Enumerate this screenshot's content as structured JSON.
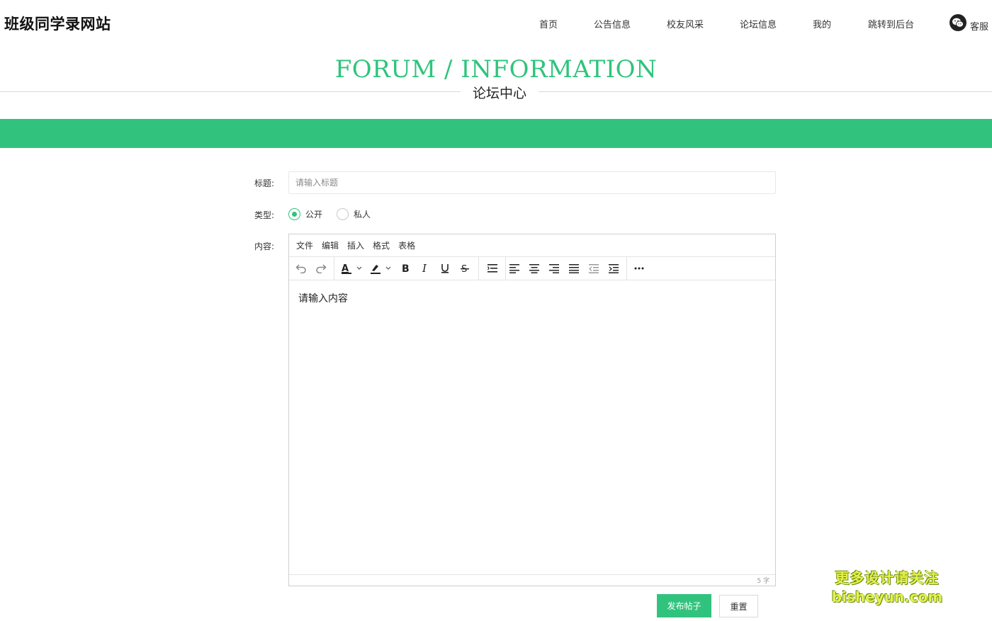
{
  "header": {
    "site_title": "班级同学录网站",
    "nav": [
      "首页",
      "公告信息",
      "校友风采",
      "论坛信息",
      "我的",
      "跳转到后台"
    ],
    "service_label": "客服"
  },
  "section": {
    "title_en": "FORUM / INFORMATION",
    "title_cn": "论坛中心"
  },
  "form": {
    "title_label": "标题:",
    "title_placeholder": "请输入标题",
    "type_label": "类型:",
    "type_options": [
      {
        "label": "公开",
        "checked": true
      },
      {
        "label": "私人",
        "checked": false
      }
    ],
    "content_label": "内容:",
    "editor": {
      "menu": [
        "文件",
        "编辑",
        "插入",
        "格式",
        "表格"
      ],
      "tools": [
        "undo-icon",
        "redo-icon",
        "text-color-icon",
        "highlight-color-icon",
        "bold-icon",
        "italic-icon",
        "underline-icon",
        "strikethrough-icon",
        "line-height-icon",
        "align-left-icon",
        "align-center-icon",
        "align-right-icon",
        "align-justify-icon",
        "outdent-icon",
        "indent-icon",
        "more-icon"
      ],
      "content": "请输入内容",
      "word_count": "5 字"
    },
    "submit_label": "发布帖子",
    "reset_label": "重置"
  },
  "watermark": {
    "line1": "更多设计请关注",
    "line2": "bisheyun.com"
  },
  "colors": {
    "accent": "#31c37d",
    "title_green": "#2fc47c"
  }
}
